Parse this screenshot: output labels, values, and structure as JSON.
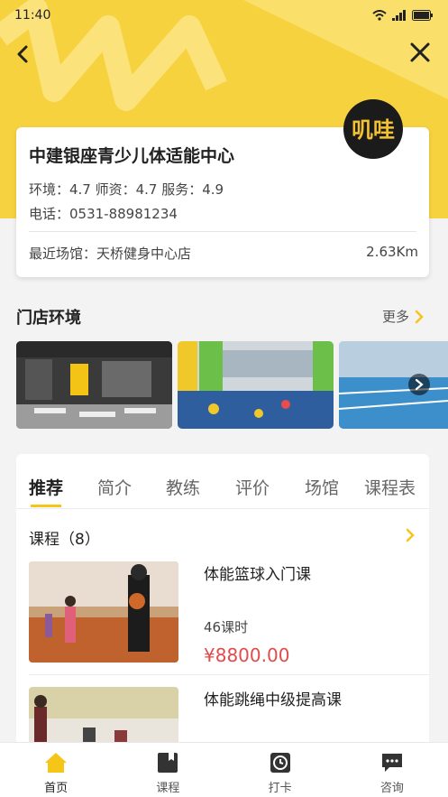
{
  "status_bar": {
    "time": "11:40"
  },
  "store": {
    "name": "中建银座青少儿体适能中心",
    "ratings": "环境：4.7  师资：4.7  服务：4.9",
    "phone": "电话：0531-88981234",
    "venue": "最近场馆：天桥健身中心店",
    "distance": "2.63Km",
    "logo_text": "叽哇"
  },
  "environment": {
    "title": "门店环境",
    "more_label": "更多"
  },
  "tabs": [
    {
      "label": "推荐"
    },
    {
      "label": "简介"
    },
    {
      "label": "教练"
    },
    {
      "label": "评价"
    },
    {
      "label": "场馆"
    },
    {
      "label": "课程表"
    }
  ],
  "courses": {
    "heading": "课程（8）",
    "items": [
      {
        "title": "体能篮球入门课",
        "lessons": "46课时",
        "price": "¥8800.00"
      },
      {
        "title": "体能跳绳中级提高课"
      }
    ]
  },
  "tabbar": [
    {
      "label": "首页",
      "icon": "home-icon"
    },
    {
      "label": "课程",
      "icon": "book-icon"
    },
    {
      "label": "打卡",
      "icon": "clock-icon"
    },
    {
      "label": "咨询",
      "icon": "chat-icon"
    }
  ],
  "colors": {
    "brand_yellow": "#f7d23f",
    "accent": "#f5c518",
    "price_red": "#e24b4b"
  }
}
